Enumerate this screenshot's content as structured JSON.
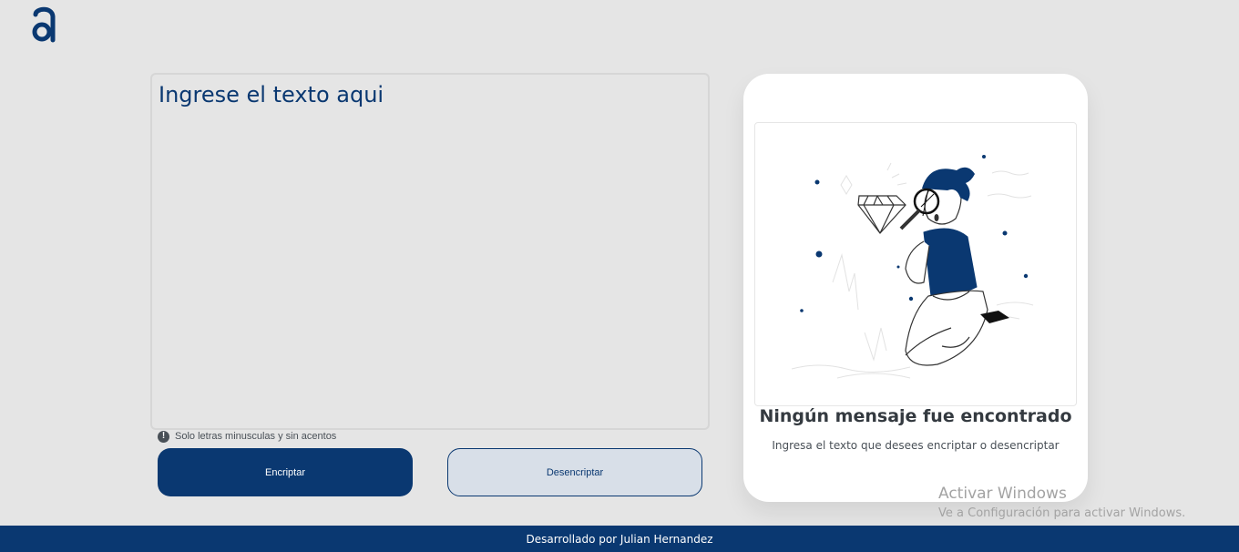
{
  "app": {
    "logo_icon": "alura-logo",
    "brand_color": "#0a3871"
  },
  "input": {
    "placeholder": "Ingrese el texto aqui",
    "value": ""
  },
  "hint": {
    "icon": "exclamation-circle-icon",
    "text": "Solo letras minusculas y sin acentos"
  },
  "buttons": {
    "encrypt_label": "Encriptar",
    "decrypt_label": "Desencriptar"
  },
  "output": {
    "illustration": "person-with-magnifying-glass-diamond",
    "title": "Ningún mensaje fue encontrado",
    "text": "Ingresa el texto que desees encriptar o desencriptar"
  },
  "watermark": {
    "title": "Activar Windows",
    "subtitle": "Ve a Configuración para activar Windows."
  },
  "footer": {
    "text": "Desarrollado por Julian Hernandez"
  }
}
